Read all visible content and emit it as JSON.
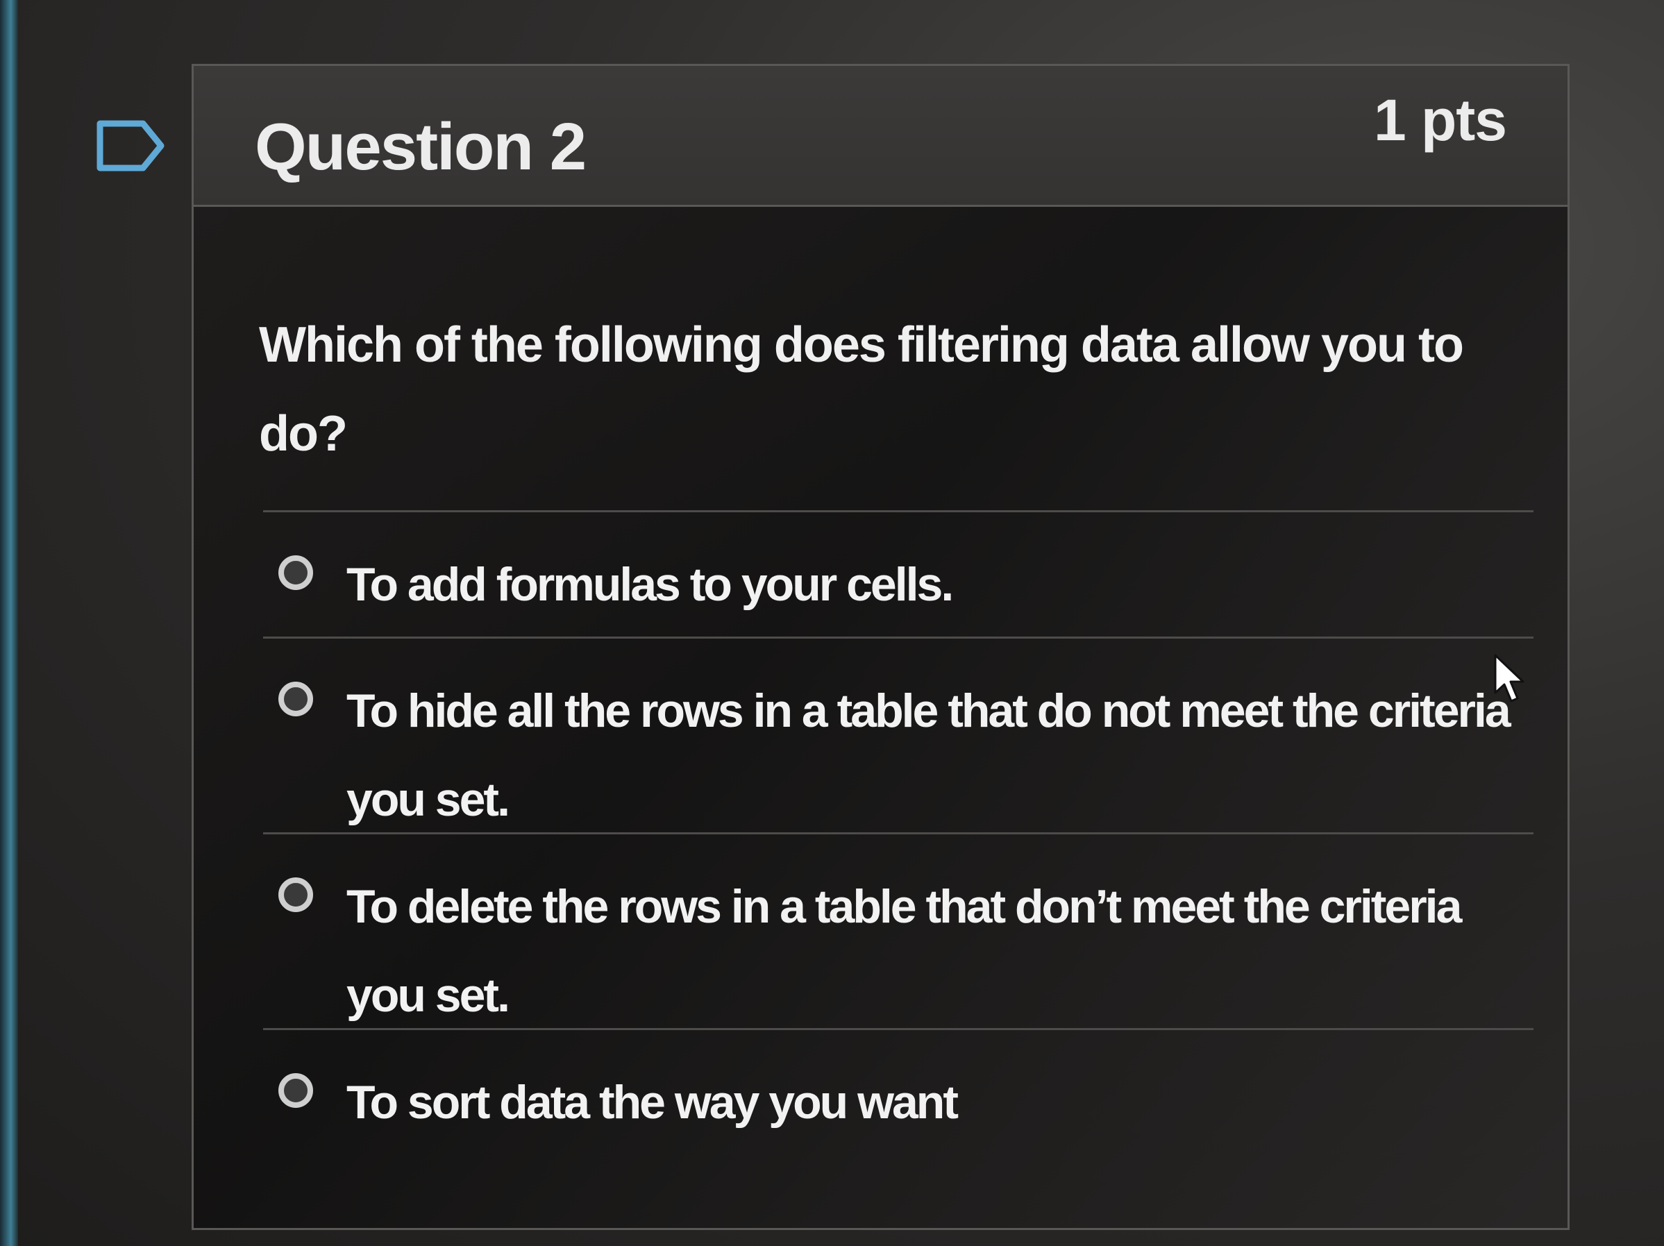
{
  "question": {
    "title": "Question 2",
    "points": "1 pts",
    "text": "Which of the following does filtering data allow you to do?"
  },
  "answers": [
    {
      "label": "To add formulas to your cells."
    },
    {
      "label": "To hide all the rows in a table that do not meet the criteria you set."
    },
    {
      "label": "To delete the rows in a table that don’t meet the criteria you set."
    },
    {
      "label": "To sort data the way you want"
    }
  ],
  "icons": {
    "flag": "flag-icon",
    "cursor": "mouse-pointer-icon"
  },
  "colors": {
    "background": "#2f2d2c",
    "card_header": "#3c3a39",
    "text": "#f0f0f0",
    "border": "#5a5856",
    "flag_outline": "#5fa9d6"
  }
}
